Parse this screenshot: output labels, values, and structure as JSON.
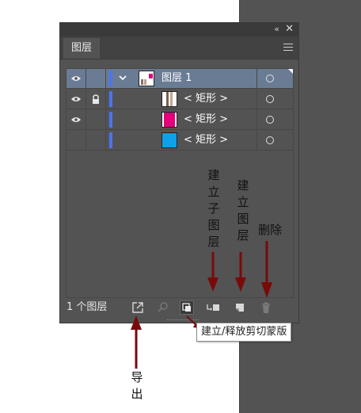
{
  "panel": {
    "collapse_glyph": "«",
    "close_glyph": "✕",
    "tab_label": "图层",
    "layers": [
      {
        "name": "图层 1",
        "visible": true,
        "locked": false,
        "selected": true,
        "thumb": "layer"
      },
      {
        "name": "< 矩形 >",
        "visible": true,
        "locked": true,
        "selected": false,
        "thumb": "stripe"
      },
      {
        "name": "< 矩形 >",
        "visible": true,
        "locked": false,
        "selected": false,
        "thumb": "magenta"
      },
      {
        "name": "< 矩形 >",
        "visible": false,
        "locked": false,
        "selected": false,
        "thumb": "cyan"
      }
    ],
    "footer": {
      "count_label": "1 个图层",
      "buttons": [
        "export-icon",
        "search-icon",
        "clipping-mask-icon",
        "sublayer-icon",
        "new-layer-icon",
        "trash-icon"
      ]
    }
  },
  "colors": {
    "panel_bg": "#535353",
    "selected_row": "#6a7b94",
    "layer_color": "#4b74ee",
    "magenta": "#e2007a",
    "cyan": "#0ea0e8",
    "arrow": "#7a0a0a"
  },
  "annotations": {
    "create_sublayer": "建立子图层",
    "create_layer": "建立图层",
    "delete": "删除",
    "export": "导出",
    "tooltip": "建立/释放剪切蒙版"
  }
}
